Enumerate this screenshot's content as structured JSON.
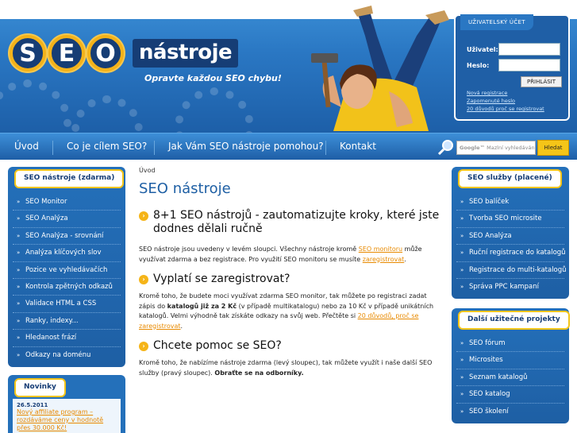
{
  "header": {
    "logo_letters": [
      "S",
      "E",
      "O"
    ],
    "logo_word": "nástroje",
    "slogan": "Opravte každou SEO chybu!"
  },
  "login": {
    "title": "UŽIVATELSKÝ ÚČET",
    "user_label": "Uživatel:",
    "pass_label": "Heslo:",
    "submit": "PŘIHLÁSIT",
    "links": [
      "Nová registrace",
      "Zapomenuté heslo",
      "20 důvodů proč se registrovat"
    ]
  },
  "nav": {
    "items": [
      "Úvod",
      "Co je cílem SEO?",
      "Jak Vám SEO nástroje pomohou?",
      "Kontakt"
    ],
    "search_brand": "Google™",
    "search_placeholder": "Mazlní vyhledávání",
    "search_button": "Hledat"
  },
  "left_sidebar": {
    "title": "SEO nástroje (zdarma)",
    "items": [
      "SEO Monitor",
      "SEO Analýza",
      "SEO Analýza - srovnání",
      "Analýza klíčových slov",
      "Pozice ve vyhledávačích",
      "Kontrola zpětných odkazů",
      "Validace HTML a CSS",
      "Ranky, indexy...",
      "Hledanost frází",
      "Odkazy na doménu"
    ]
  },
  "news": {
    "title": "Novinky",
    "date": "26.5.2011",
    "link": "Nový affiliate program – rozdáváme ceny v hodnotě přes 30.000 Kč!"
  },
  "right_sidebar_1": {
    "title": "SEO služby (placené)",
    "items": [
      "SEO balíček",
      "Tvorba SEO microsite",
      "SEO Analýza",
      "Ruční registrace do katalogů",
      "Registrace do multi-katalogů",
      "Správa PPC kampaní"
    ]
  },
  "right_sidebar_2": {
    "title": "Další užitečné projekty",
    "items": [
      "SEO fórum",
      "Microsites",
      "Seznam katalogů",
      "SEO katalog",
      "SEO školení"
    ]
  },
  "main": {
    "breadcrumb": "Úvod",
    "title": "SEO nástroje",
    "s1_heading": "8+1 SEO nástrojů - zautomatizujte kroky, které jste dodnes dělali ručně",
    "s1_text_a": "SEO nástroje jsou uvedeny v levém sloupci. Všechny nástroje kromě ",
    "s1_link1": "SEO monitoru",
    "s1_text_b": " může využívat zdarma a bez registrace. Pro využití SEO monitoru se musíte ",
    "s1_link2": "zaregistrovat",
    "s1_text_c": ".",
    "s2_heading": "Vyplatí se zaregistrovat?",
    "s2_text_a": "Kromě toho, že budete moci využívat zdarma SEO monitor, tak můžete po registraci zadat zápis do ",
    "s2_bold": "katalogů již za 2 Kč",
    "s2_text_b": " (v případě multikatalogu) nebo za 10 Kč v případě unikátních katalogů. Velmi výhodně tak získáte odkazy na svůj web. Přečtěte si ",
    "s2_link": "20 důvodů, proč se zaregistrovat",
    "s2_text_c": ".",
    "s3_heading": "Chcete pomoc se SEO?",
    "s3_text_a": "Kromě toho, že nabízíme nástroje zdarma (levý sloupec), tak můžete využít i naše další SEO služby (pravý sloupec). ",
    "s3_bold": "Obraťte se na odborníky."
  },
  "colors": {
    "brand_blue": "#1e5fa4",
    "accent_yellow": "#f5c518",
    "link_orange": "#e88a00"
  }
}
